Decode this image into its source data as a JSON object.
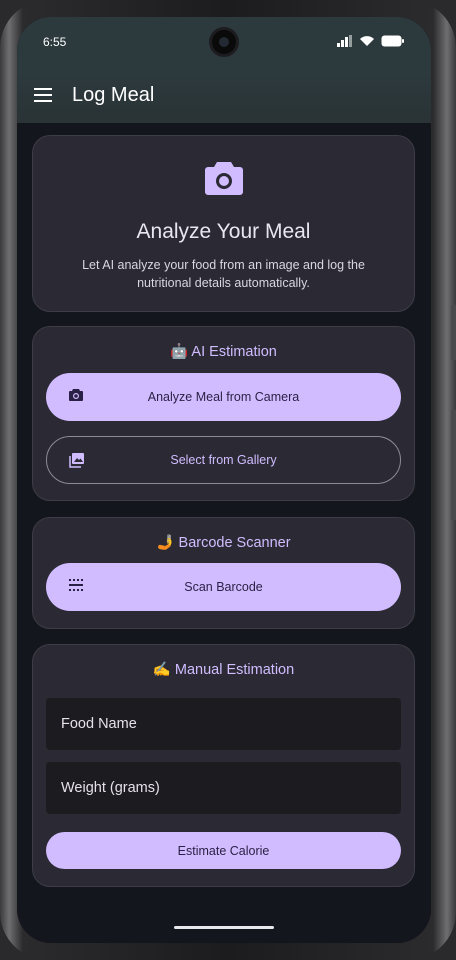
{
  "status": {
    "time": "6:55"
  },
  "appbar": {
    "title": "Log Meal"
  },
  "hero": {
    "title": "Analyze Your Meal",
    "description": "Let AI analyze your food from an image and log the nutritional details automatically."
  },
  "ai": {
    "title": "🤖 AI Estimation",
    "camera_button": "Analyze Meal from Camera",
    "gallery_button": "Select from Gallery"
  },
  "barcode": {
    "title": "🤳 Barcode Scanner",
    "scan_button": "Scan Barcode"
  },
  "manual": {
    "title": "✍️ Manual Estimation",
    "food_name_placeholder": "Food Name",
    "weight_placeholder": "Weight (grams)",
    "estimate_button": "Estimate Calorie"
  },
  "colors": {
    "accent": "#d0bcff",
    "card": "#2b2a34",
    "background": "#14161d",
    "appbar": "#2c3a3e"
  }
}
